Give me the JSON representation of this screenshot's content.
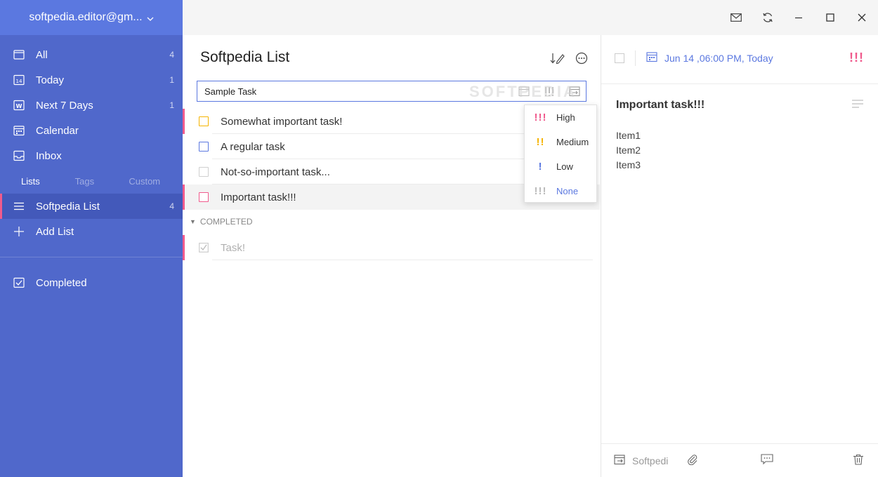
{
  "account": {
    "name": "softpedia.editor@gm...",
    "dropdown_icon": "chevron-down-icon"
  },
  "sidebar": {
    "items": [
      {
        "label": "All",
        "count": "4",
        "icon": "all-icon"
      },
      {
        "label": "Today",
        "count": "1",
        "icon": "today-calendar-icon"
      },
      {
        "label": "Next 7 Days",
        "count": "1",
        "icon": "week-icon"
      },
      {
        "label": "Calendar",
        "count": "",
        "icon": "calendar-icon"
      },
      {
        "label": "Inbox",
        "count": "",
        "icon": "inbox-icon"
      }
    ],
    "tabs": [
      "Lists",
      "Tags",
      "Custom"
    ],
    "lists": [
      {
        "label": "Softpedia List",
        "count": "4",
        "icon": "list-icon",
        "active": true
      }
    ],
    "add_list": "Add List",
    "completed": "Completed"
  },
  "window": {
    "icons": [
      "mail-icon",
      "sync-icon",
      "minimize-icon",
      "maximize-icon",
      "close-icon"
    ]
  },
  "list": {
    "title": "Softpedia List",
    "input_value": "Sample Task",
    "tasks": [
      {
        "title": "Somewhat important task!",
        "priority": "medium"
      },
      {
        "title": "A regular task",
        "priority": "low"
      },
      {
        "title": "Not-so-important task...",
        "priority": "none"
      },
      {
        "title": "Important task!!!",
        "priority": "high"
      }
    ],
    "completed_header": "COMPLETED",
    "completed_tasks": [
      {
        "title": "Task!"
      }
    ]
  },
  "priority_menu": [
    {
      "icon": "!!!",
      "label": "High",
      "color": "#f05b8d"
    },
    {
      "icon": "!!",
      "label": "Medium",
      "color": "#f5b400"
    },
    {
      "icon": "!",
      "label": "Low",
      "color": "#5b78e0"
    },
    {
      "icon": "!!!",
      "label": "None",
      "color": "#bbbbbb"
    }
  ],
  "detail": {
    "date": "Jun 14 ,06:00 PM, Today",
    "priority_icon": "!!!",
    "title": "Important task!!!",
    "body": [
      "Item1",
      "Item2",
      "Item3"
    ],
    "list_name": "Softpedi"
  },
  "watermark": "SOFTPEDIA",
  "colors": {
    "accent": "#5b78e0",
    "sidebar": "#5068cb",
    "high": "#f05b8d",
    "medium": "#f5b400",
    "low": "#5b78e0",
    "none": "#bbbbbb"
  }
}
